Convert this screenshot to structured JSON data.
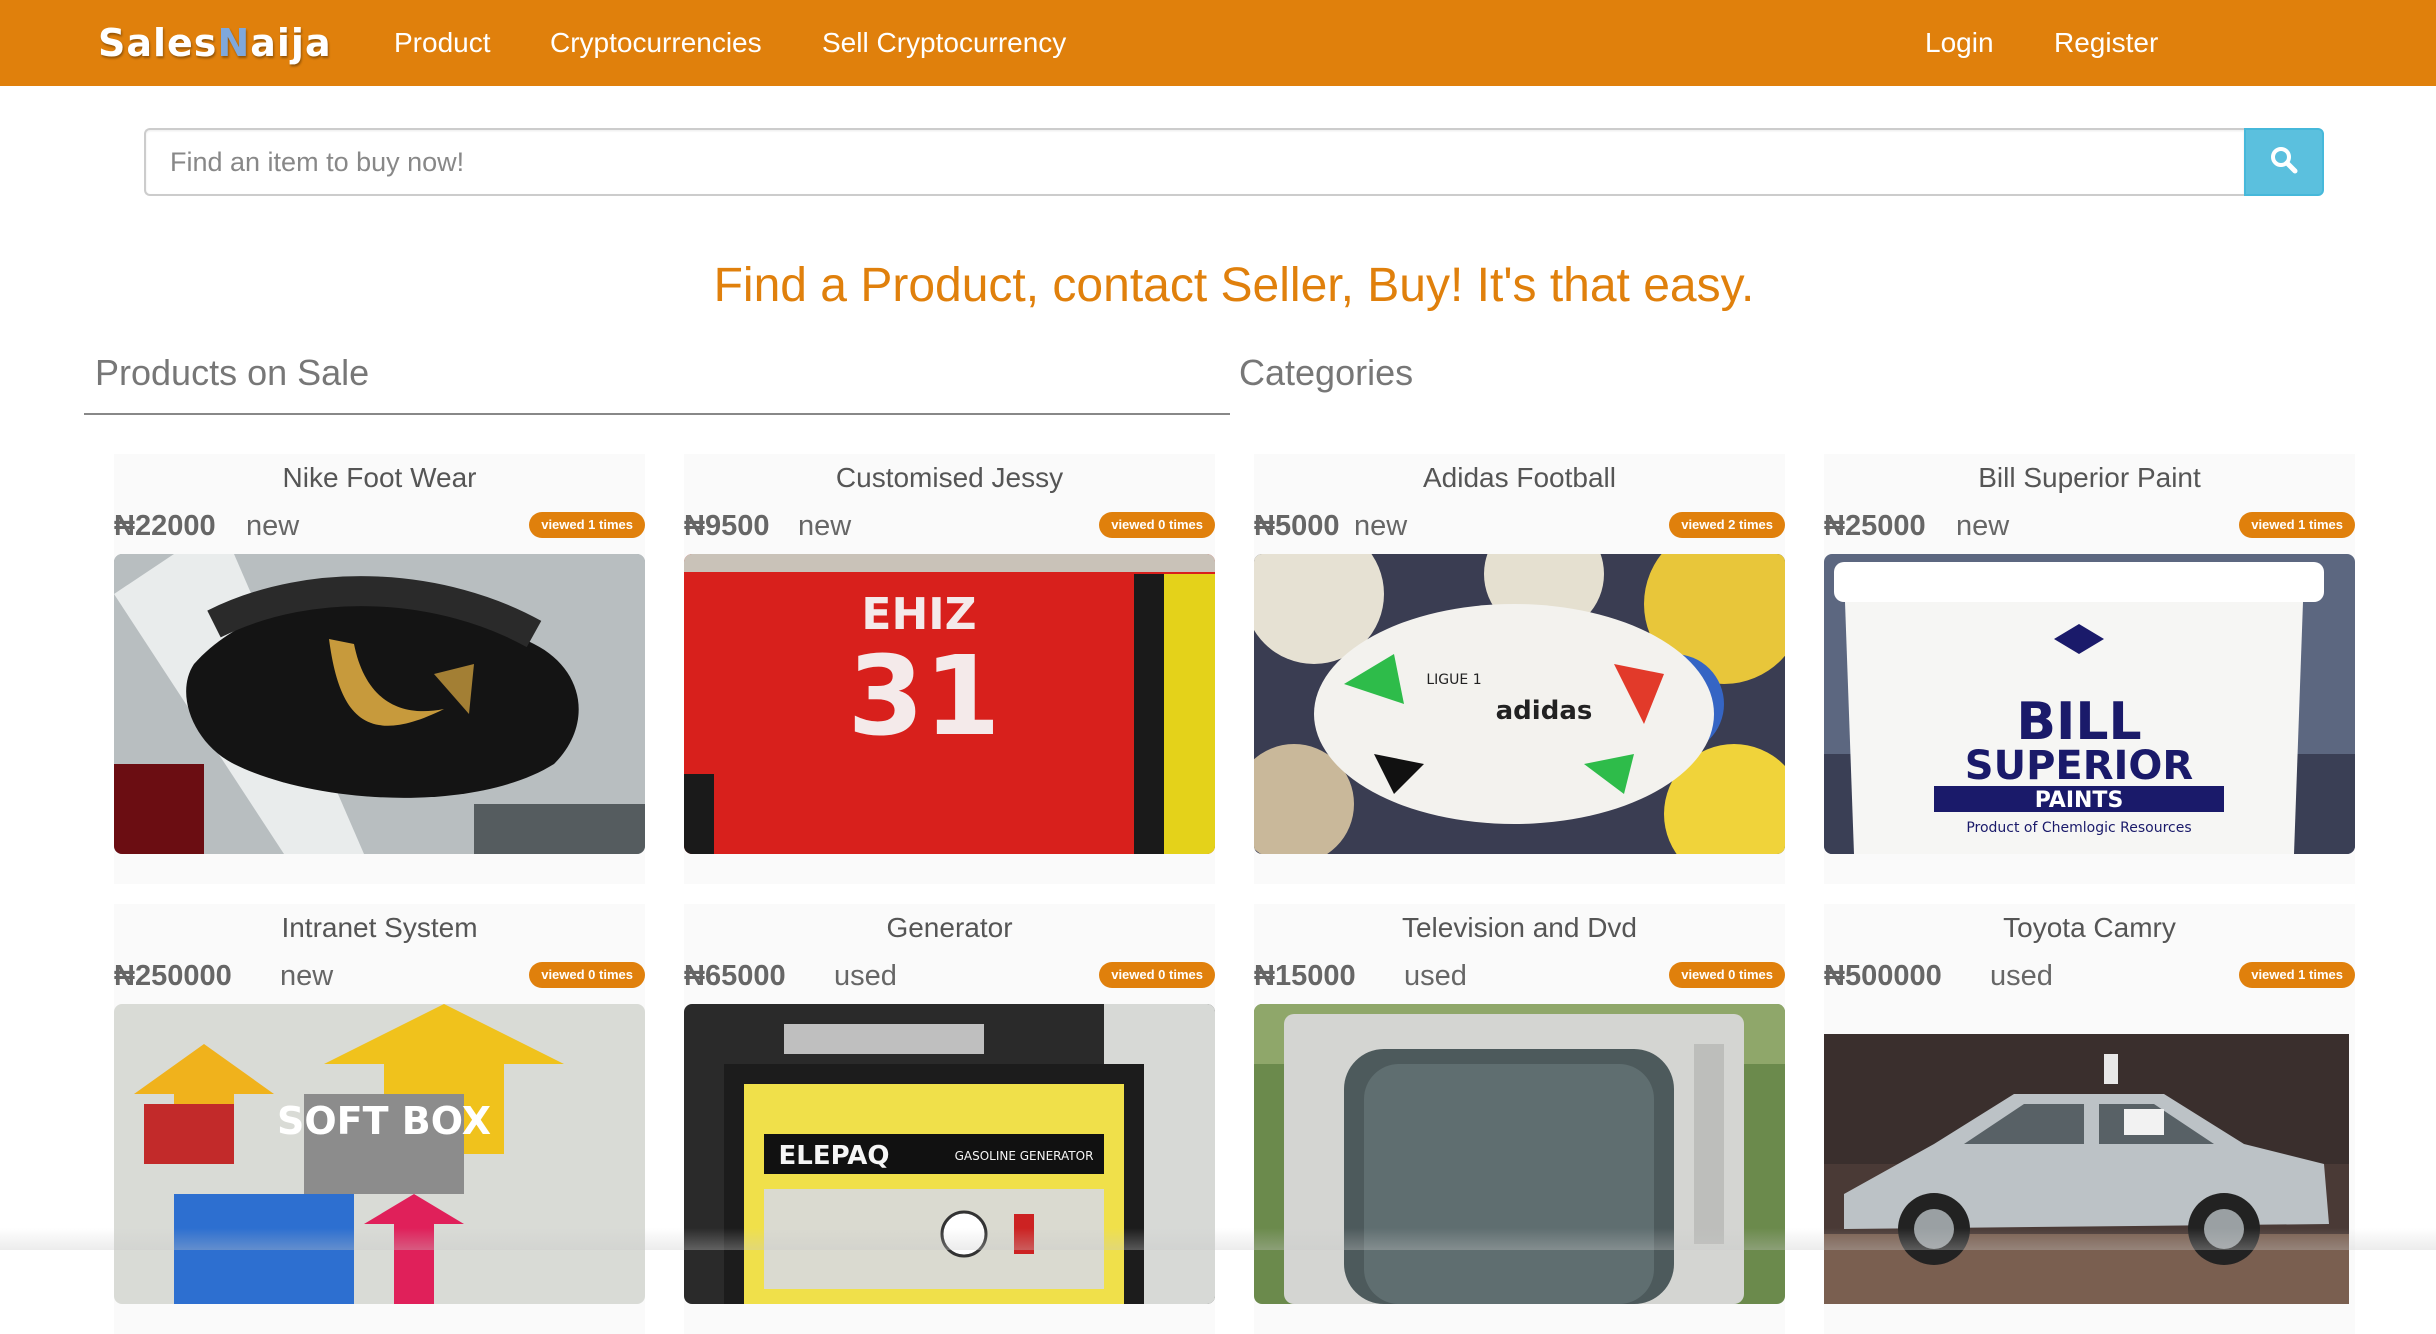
{
  "brand": {
    "part1": "Sales",
    "part2": "N",
    "part3": "aija"
  },
  "nav": {
    "left": [
      "Product",
      "Cryptocurrencies",
      "Sell Cryptocurrency"
    ],
    "right": [
      "Login",
      "Register"
    ]
  },
  "search": {
    "placeholder": "Find an item to buy now!",
    "icon": "search-icon"
  },
  "tagline": "Find a Product, contact Seller, Buy! It's that easy.",
  "sections": {
    "products": "Products on Sale",
    "categories": "Categories"
  },
  "currency_symbol": "₦",
  "colors": {
    "brand": "#e0800c",
    "search_button": "#5bc0de",
    "accent_logo": "#7fa8dc"
  },
  "products": [
    {
      "title": "Nike Foot Wear",
      "price": "₦22000",
      "condition": "new",
      "views": "viewed 1 times",
      "image": "black-nike-shoe"
    },
    {
      "title": "Customised Jessy",
      "price": "₦9500",
      "condition": "new",
      "views": "viewed 0 times",
      "image": "red-jersey"
    },
    {
      "title": "Adidas Football",
      "price": "₦5000",
      "condition": "new",
      "views": "viewed 2 times",
      "image": "adidas-ball"
    },
    {
      "title": "Bill Superior Paint",
      "price": "₦25000",
      "condition": "new",
      "views": "viewed 1 times",
      "image": "paint-bucket"
    },
    {
      "title": "Intranet System",
      "price": "₦250000",
      "condition": "new",
      "views": "viewed 0 times",
      "image": "softbox-graphic"
    },
    {
      "title": "Generator",
      "price": "₦65000",
      "condition": "used",
      "views": "viewed 0 times",
      "image": "yellow-generator"
    },
    {
      "title": "Television and Dvd",
      "price": "₦15000",
      "condition": "used",
      "views": "viewed 0 times",
      "image": "crt-television"
    },
    {
      "title": "Toyota Camry",
      "price": "₦500000",
      "condition": "used",
      "views": "viewed 1 times",
      "image": "silver-camry"
    }
  ],
  "image_text": {
    "jersey_name": "EHIZ",
    "jersey_number": "31",
    "ball_brand": "adidas",
    "ball_league": "LIGUE 1",
    "paint_line1": "BILL",
    "paint_line2": "SUPERIOR",
    "paint_line3": "PAINTS",
    "paint_sub": "Product of Chemlogic Resources",
    "softbox": "SOFT BOX",
    "generator_brand": "ELEPAQ",
    "generator_model": "GASOLINE GENERATOR"
  }
}
